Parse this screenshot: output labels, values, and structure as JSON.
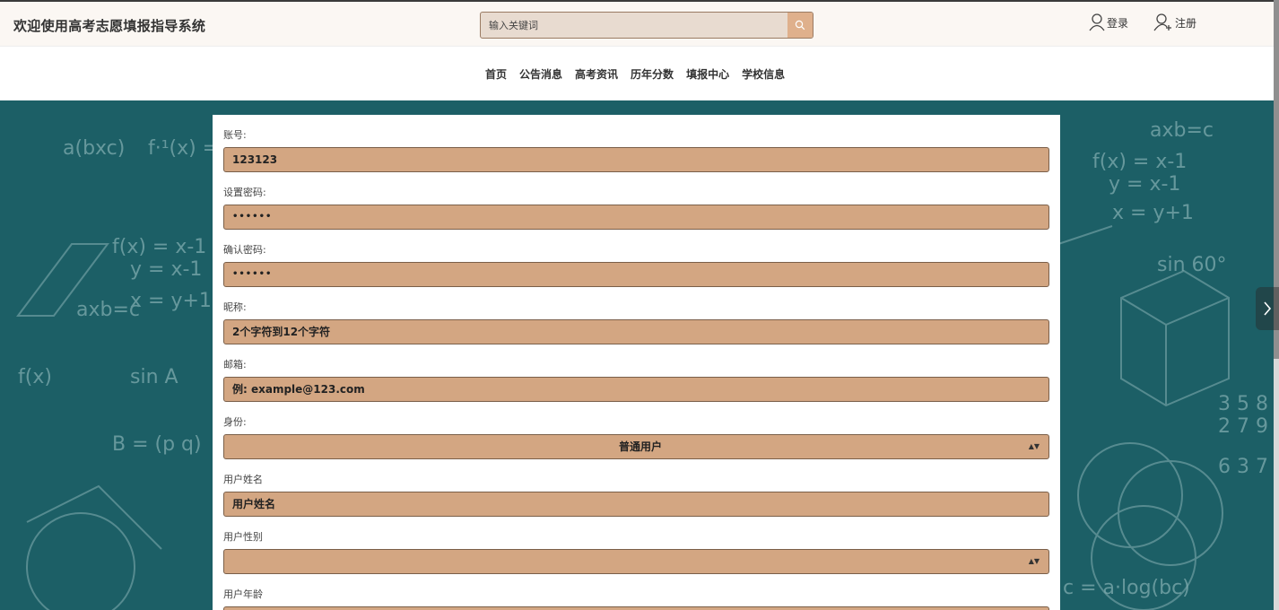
{
  "header": {
    "site_title": "欢迎使用高考志愿填报指导系统",
    "search_placeholder": "输入关键词",
    "login_label": "登录",
    "register_label": "注册"
  },
  "nav": {
    "items": [
      "首页",
      "公告消息",
      "高考资讯",
      "历年分数",
      "填报中心",
      "学校信息"
    ]
  },
  "form": {
    "account_label": "账号:",
    "account_value": "123123",
    "password_label": "设置密码:",
    "password_value": "••••••",
    "confirm_label": "确认密码:",
    "confirm_value": "••••••",
    "nickname_label": "昵称:",
    "nickname_value": "2个字符到12个字符",
    "email_label": "邮箱:",
    "email_value": "例: example@123.com",
    "identity_label": "身份:",
    "identity_value": "普通用户",
    "realname_label": "用户姓名",
    "realname_value": "用户姓名",
    "gender_label": "用户性别",
    "gender_value": "",
    "age_label": "用户年龄"
  },
  "colors": {
    "field_bg": "#d3a682",
    "banner_bg": "#1c5f66",
    "search_btn": "#dfb08c"
  },
  "icons": {
    "search": "magnifier-icon",
    "login": "user-icon",
    "register": "user-plus-icon",
    "next": "chevron-right-icon"
  }
}
